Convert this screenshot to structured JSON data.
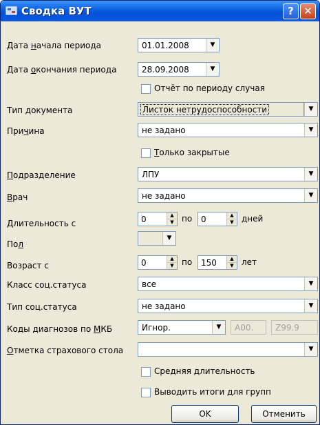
{
  "window": {
    "title": "Сводка ВУТ",
    "help_label": "?",
    "close_label": "✕"
  },
  "form": {
    "period_start": {
      "label_pre": "Дата ",
      "label_u": "н",
      "label_post": "ачала периода",
      "value": "01.01.2008"
    },
    "period_end": {
      "label_pre": "Дата ",
      "label_u": "о",
      "label_post": "кончания периода",
      "value": "28.09.2008"
    },
    "case_period_report": {
      "label": "Отчёт по периоду случая",
      "checked": false
    },
    "doc_type": {
      "label_pre": "Тип ",
      "label_u": "д",
      "label_post": "окумента",
      "value": "Листок нетрудоспособности"
    },
    "reason": {
      "label_pre": "При",
      "label_u": "ч",
      "label_post": "ина",
      "value": "не задано"
    },
    "closed_only": {
      "label_u": "Т",
      "label_post": "олько закрытые",
      "checked": false
    },
    "department": {
      "label_u": "П",
      "label_post": "одразделение",
      "value": "ЛПУ"
    },
    "doctor": {
      "label_u": "В",
      "label_post": "рач",
      "value": "не задано"
    },
    "duration": {
      "label_u": "Д",
      "label_post": "лительность с",
      "from": "0",
      "to_label": "по",
      "to": "0",
      "unit": "дней"
    },
    "sex": {
      "label_pre": "По",
      "label_u": "л",
      "label_post": "",
      "value": ""
    },
    "age": {
      "label": "Возраст с",
      "from": "0",
      "to_label": "по",
      "to": "150",
      "unit": "лет"
    },
    "social_class": {
      "label": "Класс соц.статуса",
      "value": "все"
    },
    "social_type": {
      "label": "Тип соц.статуса",
      "value": "не задано"
    },
    "icd_codes": {
      "label_pre": "Коды диагнозов по ",
      "label_u": "М",
      "label_post": "КБ",
      "mode": "Игнор.",
      "from": "A00.",
      "to": "Z99.9"
    },
    "insurance_mark": {
      "label_u": "О",
      "label_post": "тметка страхового стола",
      "value": ""
    },
    "avg_duration": {
      "label": "Средняя длительность",
      "checked": false
    },
    "group_totals": {
      "label": "Выводить итоги для групп",
      "checked": false
    }
  },
  "buttons": {
    "ok": "OK",
    "cancel": "Отменить"
  },
  "colors": {
    "titlebar": "#0a5fe0",
    "dialog_bg": "#ece9d8",
    "field_border": "#7f9db9"
  }
}
